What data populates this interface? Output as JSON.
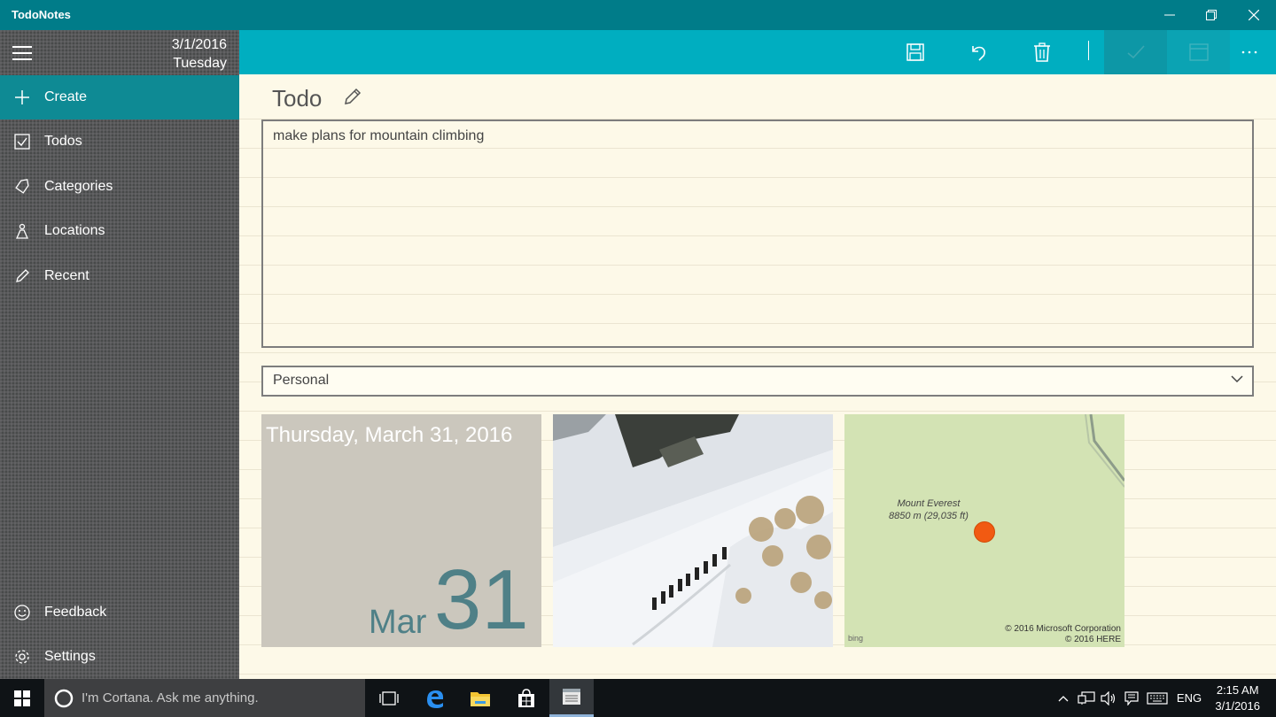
{
  "window": {
    "title": "TodoNotes"
  },
  "sidebar": {
    "date": "3/1/2016",
    "weekday": "Tuesday",
    "items": [
      {
        "label": "Create",
        "icon": "plus-icon",
        "active": true
      },
      {
        "label": "Todos",
        "icon": "checkbox-icon"
      },
      {
        "label": "Categories",
        "icon": "tag-icon"
      },
      {
        "label": "Locations",
        "icon": "location-icon"
      },
      {
        "label": "Recent",
        "icon": "pencil-icon"
      }
    ],
    "footer": [
      {
        "label": "Feedback",
        "icon": "smiley-icon"
      },
      {
        "label": "Settings",
        "icon": "gear-icon"
      }
    ]
  },
  "commandbar": {
    "buttons": [
      "save-icon",
      "undo-icon",
      "delete-icon",
      "check-icon",
      "calendar-icon",
      "more-icon"
    ]
  },
  "main": {
    "title": "Todo",
    "note_text": "make plans for mountain climbing",
    "category": "Personal",
    "date_tile": {
      "full": "Thursday, March 31, 2016",
      "month": "Mar",
      "day": "31"
    },
    "map_tile": {
      "place": "Mount Everest",
      "elevation": "8850 m (29,035 ft)",
      "bing": "bing",
      "copyright1": "© 2016 Microsoft Corporation",
      "copyright2": "© 2016 HERE"
    }
  },
  "taskbar": {
    "search_placeholder": "I'm Cortana. Ask me anything.",
    "language": "ENG",
    "time": "2:15 AM",
    "date": "3/1/2016"
  },
  "colors": {
    "titlebar": "#007c89",
    "commandbar": "#00aec0",
    "active_item": "#0e8a94",
    "map_pin": "#f15a12"
  }
}
